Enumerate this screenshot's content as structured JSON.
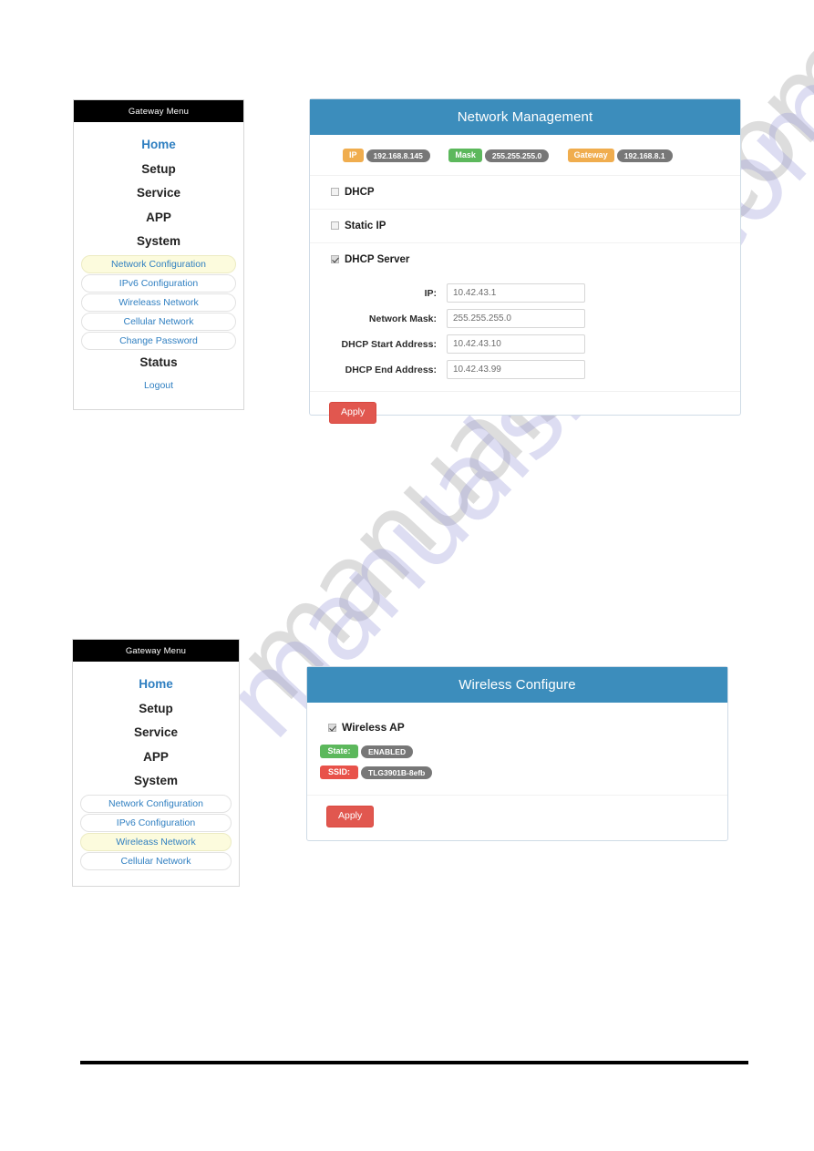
{
  "page": {
    "watermark_text": "manualshelf.com"
  },
  "sidebar_top": {
    "title": "Gateway Menu",
    "top_items": [
      {
        "label": "Home",
        "style": "link"
      },
      {
        "label": "Setup",
        "style": "bold"
      },
      {
        "label": "Service",
        "style": "bold"
      },
      {
        "label": "APP",
        "style": "bold"
      },
      {
        "label": "System",
        "style": "bold"
      }
    ],
    "sub_items": [
      {
        "label": "Network Configuration",
        "active": true
      },
      {
        "label": "IPv6 Configuration",
        "active": false
      },
      {
        "label": "Wireleass Network",
        "active": false
      },
      {
        "label": "Cellular Network",
        "active": false
      },
      {
        "label": "Change Password",
        "active": false
      }
    ],
    "status_label": "Status",
    "logout_label": "Logout"
  },
  "sidebar_bottom": {
    "title": "Gateway Menu",
    "top_items": [
      {
        "label": "Home",
        "style": "link"
      },
      {
        "label": "Setup",
        "style": "bold"
      },
      {
        "label": "Service",
        "style": "bold"
      },
      {
        "label": "APP",
        "style": "bold"
      },
      {
        "label": "System",
        "style": "bold"
      }
    ],
    "sub_items": [
      {
        "label": "Network Configuration",
        "active": false
      },
      {
        "label": "IPv6 Configuration",
        "active": false
      },
      {
        "label": "Wireleass Network",
        "active": true
      },
      {
        "label": "Cellular Network",
        "active": false
      }
    ]
  },
  "network_panel": {
    "title": "Network Management",
    "badges": [
      {
        "key": "IP",
        "value": "192.168.8.145",
        "key_color": "#f0ad4e"
      },
      {
        "key": "Mask",
        "value": "255.255.255.0",
        "key_color": "#5cb85c"
      },
      {
        "key": "Gateway",
        "value": "192.168.8.1",
        "key_color": "#f0ad4e"
      }
    ],
    "options": [
      {
        "label": "DHCP",
        "checked": false
      },
      {
        "label": "Static IP",
        "checked": false
      },
      {
        "label": "DHCP Server",
        "checked": true
      }
    ],
    "fields": [
      {
        "label": "IP:",
        "value": "10.42.43.1"
      },
      {
        "label": "Network Mask:",
        "value": "255.255.255.0"
      },
      {
        "label": "DHCP Start Address:",
        "value": "10.42.43.10"
      },
      {
        "label": "DHCP End Address:",
        "value": "10.42.43.99"
      }
    ],
    "apply_label": "Apply"
  },
  "wireless_panel": {
    "title": "Wireless Configure",
    "ap_option": {
      "label": "Wireless AP",
      "checked": true
    },
    "badges": [
      {
        "key": "State:",
        "value": "ENABLED",
        "key_color": "#5cb85c"
      },
      {
        "key": "SSID:",
        "value": "TLG3901B-8efb",
        "key_color": "#e8524a"
      }
    ],
    "apply_label": "Apply"
  }
}
